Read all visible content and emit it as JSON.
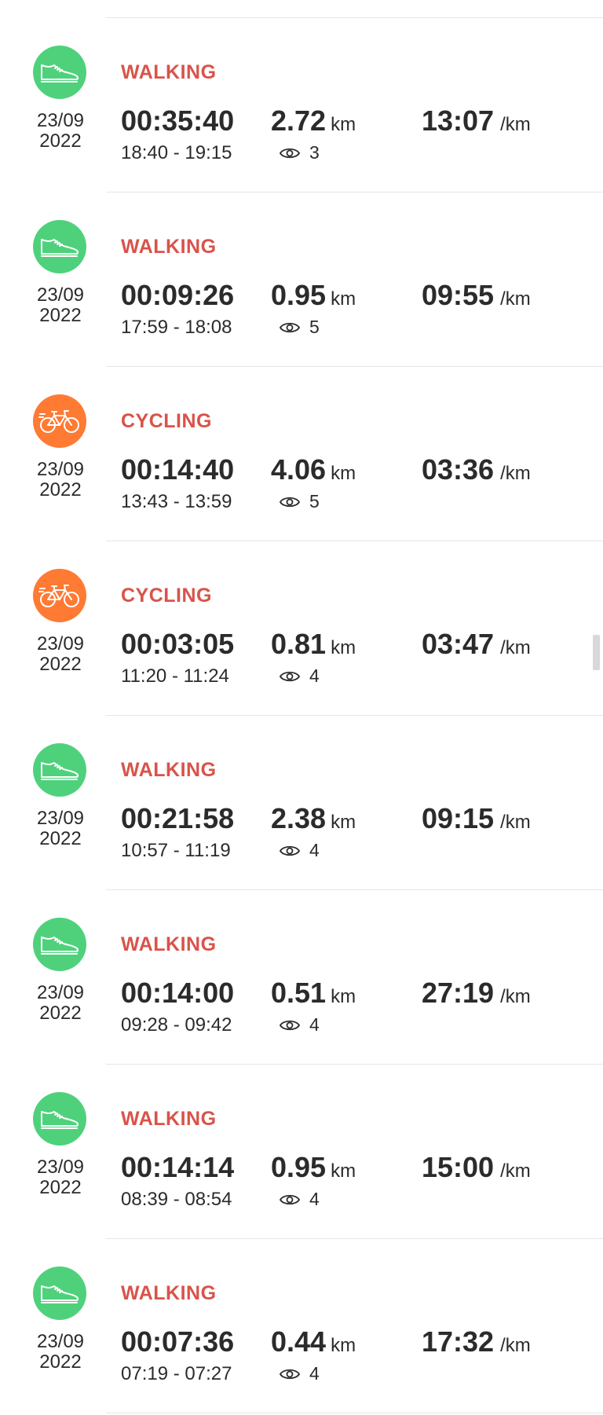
{
  "colors": {
    "walking": "#4fd17c",
    "cycling": "#ff7a33",
    "type_label": "#d9534a"
  },
  "activities": [
    {
      "type": "WALKING",
      "icon": "shoe-icon",
      "date_day": "23/09",
      "date_year": "2022",
      "duration": "00:35:40",
      "time_range": "18:40 - 19:15",
      "distance": "2.72",
      "distance_unit": "km",
      "views": "3",
      "pace": "13:07",
      "pace_unit": "/km"
    },
    {
      "type": "WALKING",
      "icon": "shoe-icon",
      "date_day": "23/09",
      "date_year": "2022",
      "duration": "00:09:26",
      "time_range": "17:59 - 18:08",
      "distance": "0.95",
      "distance_unit": "km",
      "views": "5",
      "pace": "09:55",
      "pace_unit": "/km"
    },
    {
      "type": "CYCLING",
      "icon": "bicycle-icon",
      "date_day": "23/09",
      "date_year": "2022",
      "duration": "00:14:40",
      "time_range": "13:43 - 13:59",
      "distance": "4.06",
      "distance_unit": "km",
      "views": "5",
      "pace": "03:36",
      "pace_unit": "/km"
    },
    {
      "type": "CYCLING",
      "icon": "bicycle-icon",
      "date_day": "23/09",
      "date_year": "2022",
      "duration": "00:03:05",
      "time_range": "11:20 - 11:24",
      "distance": "0.81",
      "distance_unit": "km",
      "views": "4",
      "pace": "03:47",
      "pace_unit": "/km"
    },
    {
      "type": "WALKING",
      "icon": "shoe-icon",
      "date_day": "23/09",
      "date_year": "2022",
      "duration": "00:21:58",
      "time_range": "10:57 - 11:19",
      "distance": "2.38",
      "distance_unit": "km",
      "views": "4",
      "pace": "09:15",
      "pace_unit": "/km"
    },
    {
      "type": "WALKING",
      "icon": "shoe-icon",
      "date_day": "23/09",
      "date_year": "2022",
      "duration": "00:14:00",
      "time_range": "09:28 - 09:42",
      "distance": "0.51",
      "distance_unit": "km",
      "views": "4",
      "pace": "27:19",
      "pace_unit": "/km"
    },
    {
      "type": "WALKING",
      "icon": "shoe-icon",
      "date_day": "23/09",
      "date_year": "2022",
      "duration": "00:14:14",
      "time_range": "08:39 - 08:54",
      "distance": "0.95",
      "distance_unit": "km",
      "views": "4",
      "pace": "15:00",
      "pace_unit": "/km"
    },
    {
      "type": "WALKING",
      "icon": "shoe-icon",
      "date_day": "23/09",
      "date_year": "2022",
      "duration": "00:07:36",
      "time_range": "07:19 - 07:27",
      "distance": "0.44",
      "distance_unit": "km",
      "views": "4",
      "pace": "17:32",
      "pace_unit": "/km"
    }
  ]
}
